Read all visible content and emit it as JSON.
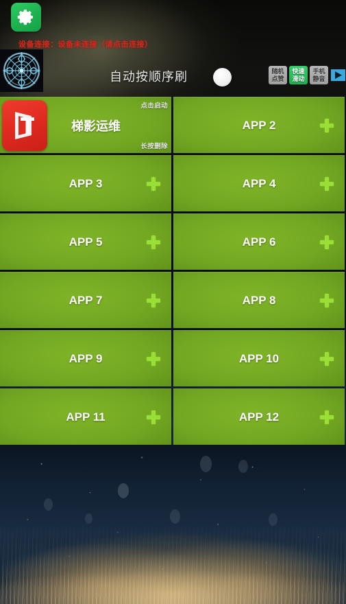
{
  "statusbar": {
    "connection_text": "设备连接：设备未连接（请点击连接）",
    "connection_color": "#cc2b20"
  },
  "toolbar": {
    "settings_icon": "gear-icon",
    "compass_icon": "compass-icon",
    "auto_mode_label": "自动按顺序刷",
    "toggle_state": "off",
    "badges": [
      {
        "id": "random-like",
        "line1": "随机",
        "line2": "点赞",
        "style": "gray"
      },
      {
        "id": "fast-swipe",
        "line1": "快速",
        "line2": "滑动",
        "style": "green"
      },
      {
        "id": "phone-mute",
        "line1": "手机",
        "line2": "静音",
        "style": "gray"
      }
    ],
    "play_icon": "play-icon",
    "play_color": "#39a9dd"
  },
  "grid": {
    "hint_tap": "点击启动",
    "hint_longpress": "长按删除",
    "accent_green": "#72a722",
    "plus_color": "#9ade36",
    "cards": [
      {
        "title": "梯影运维",
        "has_app": true,
        "icon": "ladder-shadow-app-icon",
        "icon_color": "#e02a20"
      },
      {
        "title": "APP 2",
        "has_app": false
      },
      {
        "title": "APP 3",
        "has_app": false
      },
      {
        "title": "APP 4",
        "has_app": false
      },
      {
        "title": "APP 5",
        "has_app": false
      },
      {
        "title": "APP 6",
        "has_app": false
      },
      {
        "title": "APP 7",
        "has_app": false
      },
      {
        "title": "APP 8",
        "has_app": false
      },
      {
        "title": "APP 9",
        "has_app": false
      },
      {
        "title": "APP 10",
        "has_app": false
      },
      {
        "title": "APP 11",
        "has_app": false
      },
      {
        "title": "APP 12",
        "has_app": false
      }
    ]
  }
}
